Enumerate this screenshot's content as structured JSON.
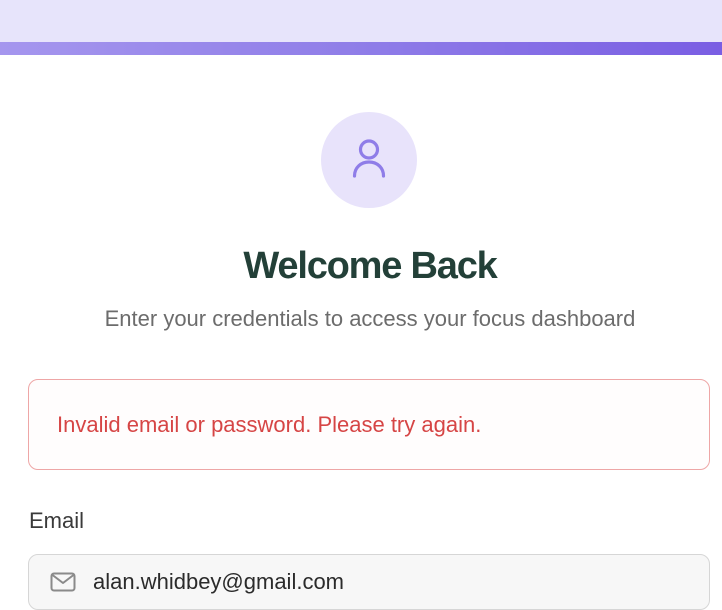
{
  "header": {
    "title": "Welcome Back",
    "subtitle": "Enter your credentials to access your focus dashboard"
  },
  "avatar": {
    "icon": "user-icon",
    "accent": "#8f7de8"
  },
  "error": {
    "message": "Invalid email or password. Please try again."
  },
  "form": {
    "email_label": "Email",
    "email_value": "alan.whidbey@gmail.com",
    "email_icon": "mail-icon"
  },
  "colors": {
    "accent": "#7a5ee3",
    "title": "#234038",
    "error": "#d64545"
  }
}
